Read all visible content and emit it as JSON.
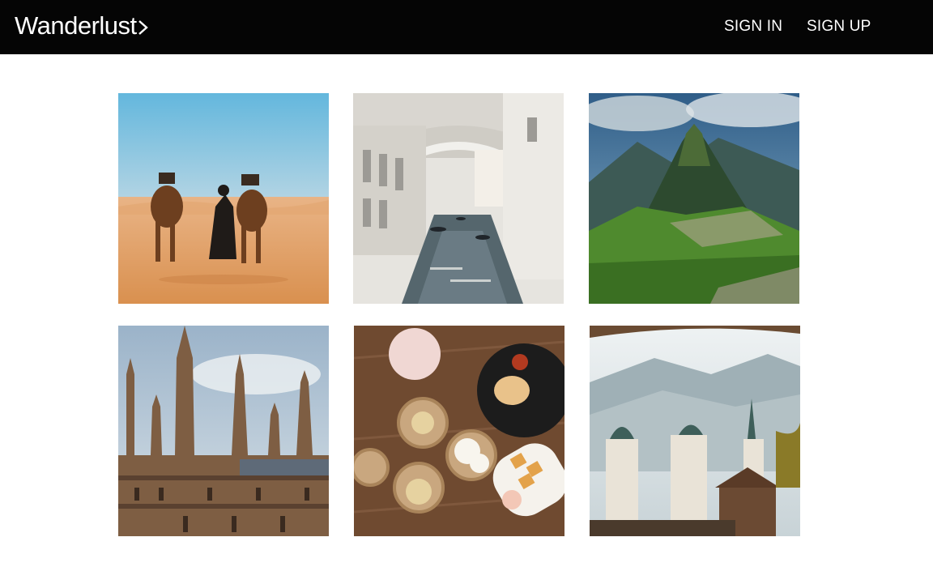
{
  "header": {
    "brand": "Wanderlust",
    "brand_icon": "chevron-right-icon",
    "signin_label": "SIGN IN",
    "signup_label": "SIGN UP"
  },
  "gallery": {
    "photos": [
      {
        "subject": "camels-desert"
      },
      {
        "subject": "venice-canal"
      },
      {
        "subject": "machu-picchu"
      },
      {
        "subject": "westminster-palace"
      },
      {
        "subject": "dim-sum-table"
      },
      {
        "subject": "salzburg-rooftops"
      }
    ]
  },
  "colors": {
    "navbar_bg": "#050505",
    "nav_text": "#ffffff",
    "page_bg": "#ffffff"
  }
}
